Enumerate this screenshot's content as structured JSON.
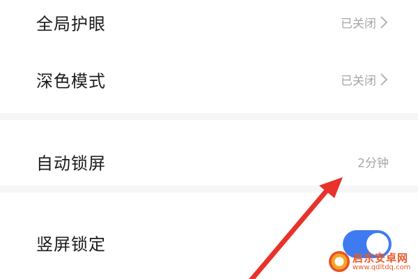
{
  "settings": {
    "items": [
      {
        "label": "全局护眼",
        "value": "已关闭"
      },
      {
        "label": "深色模式",
        "value": "已关闭"
      },
      {
        "label": "自动锁屏",
        "value": "2分钟"
      },
      {
        "label": "竖屏锁定",
        "toggle_on": true
      }
    ]
  },
  "icons": {
    "chevron": "chevron-right-icon",
    "arrow": "red-pointer-arrow"
  },
  "colors": {
    "toggle_on": "#3f7bf0",
    "arrow": "#e8322b",
    "watermark": "#e85a2a"
  },
  "watermark": {
    "name": "启东安卓网",
    "url": "www.qdltdq.com"
  }
}
